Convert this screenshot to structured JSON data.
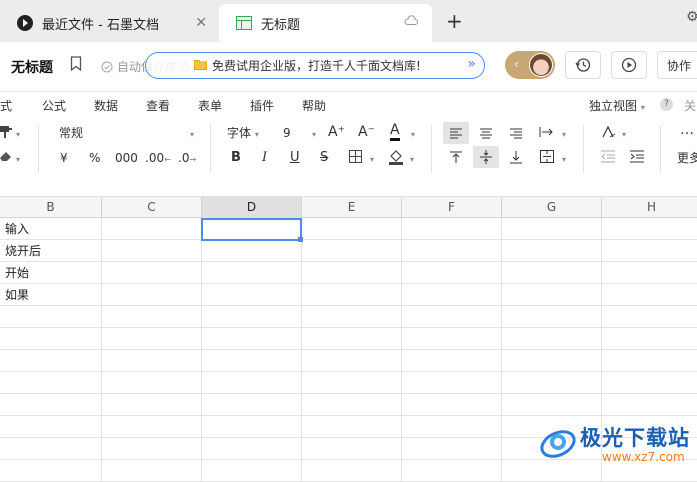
{
  "tabs": [
    {
      "title": "最近文件 - 石墨文档",
      "close": "✕"
    },
    {
      "title": "无标题"
    }
  ],
  "new_tab": "+",
  "header": {
    "doc_title": "无标题",
    "save_status": "自动保存成功",
    "promo": "免费试用企业版，打造千人千面文档库!",
    "promo_arrow": "»",
    "avatar_chevron": "‹",
    "collab_label": "协作"
  },
  "menu": [
    "式",
    "公式",
    "数据",
    "查看",
    "表单",
    "插件",
    "帮助"
  ],
  "menu_right": {
    "standalone_view": "独立视图",
    "help_badge": "?",
    "close": "关"
  },
  "toolbar": {
    "format": "常规",
    "font": "字体",
    "font_size": "9",
    "font_grow": "A⁺",
    "font_shrink": "A⁻",
    "font_color": "A",
    "currency": "¥",
    "percent": "%",
    "thousands": "000",
    "dec_increase": ".00",
    "dec_decrease": ".0",
    "bold": "B",
    "italic": "I",
    "underline": "U",
    "strike": "S",
    "more": "更多"
  },
  "grid": {
    "columns": [
      "B",
      "C",
      "D",
      "E",
      "F",
      "G",
      "H"
    ],
    "active_column": "D",
    "column_b_values": [
      "输入",
      "烧开后",
      "开始",
      "如果"
    ]
  },
  "watermark": {
    "name": "极光下载站",
    "url": "www.xz7.com"
  }
}
